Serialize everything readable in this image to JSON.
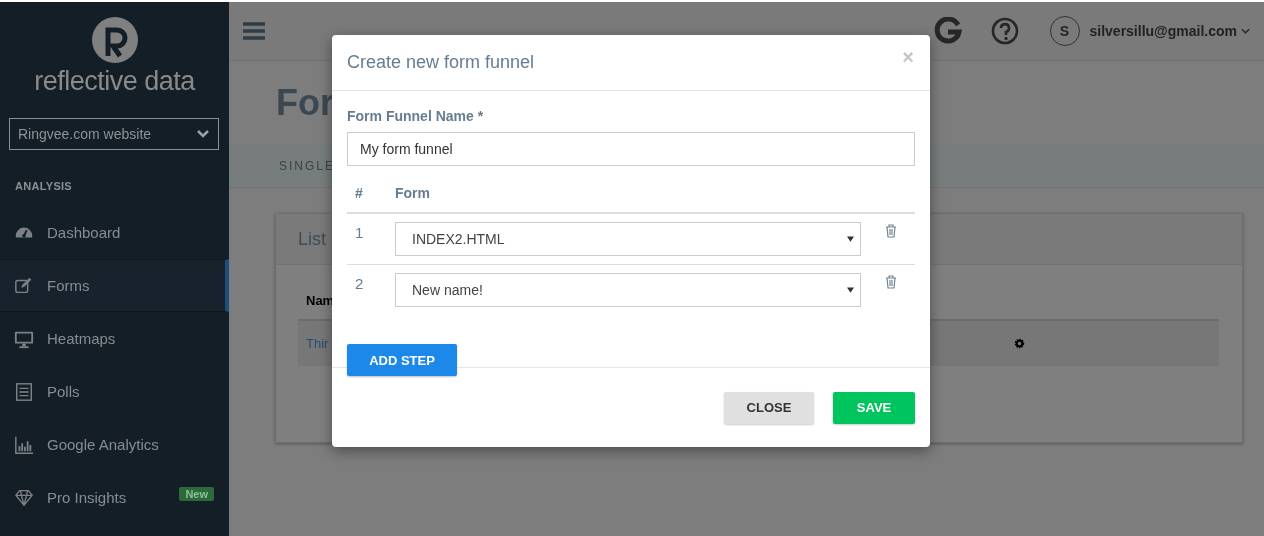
{
  "sidebar": {
    "brand": "reflective data",
    "site_select": {
      "value": "Ringvee.com website"
    },
    "section": "ANALYSIS",
    "items": [
      {
        "label": "Dashboard",
        "kind": "gauge",
        "selected": false
      },
      {
        "label": "Forms",
        "kind": "edit",
        "selected": true
      },
      {
        "label": "Heatmaps",
        "kind": "monitor",
        "selected": false
      },
      {
        "label": "Polls",
        "kind": "list",
        "selected": false
      },
      {
        "label": "Google Analytics",
        "kind": "chart",
        "selected": false
      },
      {
        "label": "Pro Insights",
        "kind": "diamond",
        "selected": false,
        "badge": "New"
      }
    ]
  },
  "topbar": {
    "avatar": "S",
    "user": "silversillu@gmail.com"
  },
  "page": {
    "title": "For",
    "tab": "SINGLE",
    "card": {
      "title": "List",
      "column_1": "Nam",
      "cell": "Thir"
    }
  },
  "modal": {
    "title": "Create new form funnel",
    "close_glyph": "×",
    "name_label": "Form Funnel Name *",
    "name_value": "My form funnel",
    "columns": [
      "#",
      "Form"
    ],
    "steps": [
      {
        "number": "1",
        "form": "INDEX2.HTML"
      },
      {
        "number": "2",
        "form": "New name!"
      }
    ],
    "add_button": "ADD STEP",
    "buttons": [
      {
        "label": "CLOSE",
        "kind": "secondary"
      },
      {
        "label": "SAVE",
        "kind": "primary"
      }
    ]
  }
}
